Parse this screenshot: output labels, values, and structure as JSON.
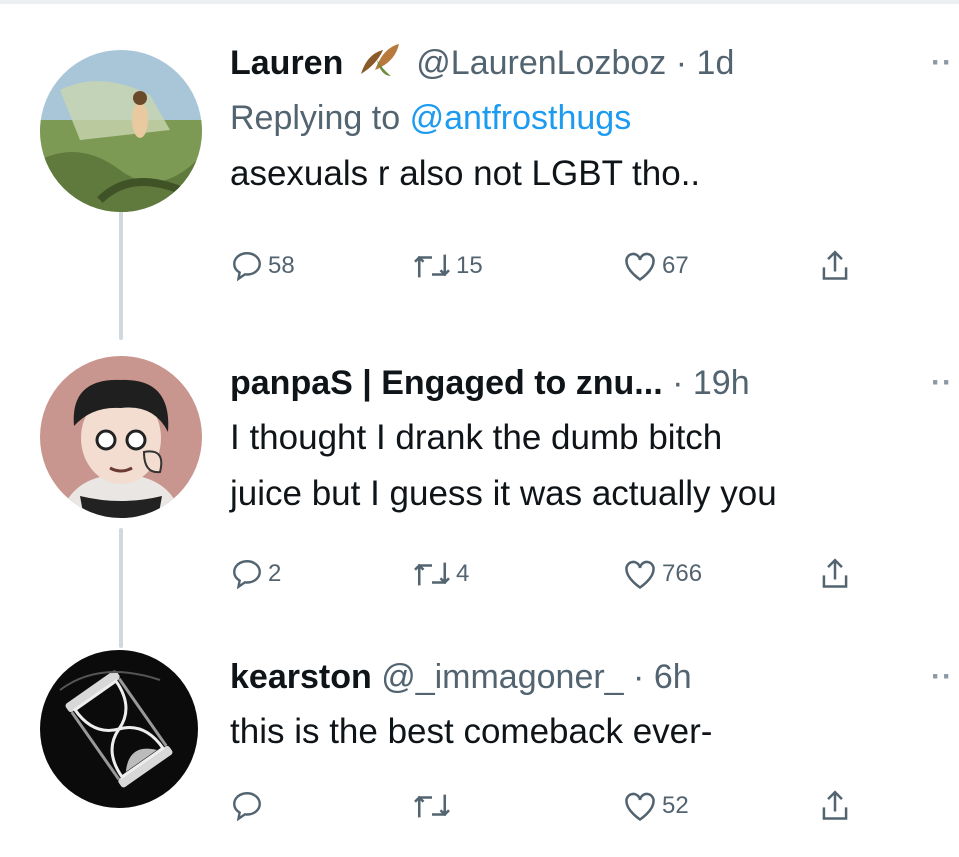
{
  "tweets": [
    {
      "name": "Lauren",
      "handle": "@LaurenLozboz",
      "separator": "·",
      "time": "1d",
      "replying_prefix": "Replying to",
      "replying_to": "@antfrosthugs",
      "text": [
        "asexuals r also not LGBT tho.."
      ],
      "replies": "58",
      "retweets": "15",
      "likes": "67",
      "more": "··"
    },
    {
      "name": "panpaS | Engaged to znu...",
      "separator": "·",
      "time": "19h",
      "text": [
        "I thought I drank the dumb bitch",
        "juice but I guess it was actually you"
      ],
      "replies": "2",
      "retweets": "4",
      "likes": "766",
      "more": "··"
    },
    {
      "name": "kearston",
      "handle": "@_immagoner_",
      "separator": "·",
      "time": "6h",
      "text": [
        "this is the best comeback ever-"
      ],
      "likes": "52",
      "more": "··"
    }
  ],
  "colors": {
    "text": "#0f1419",
    "secondary": "#536471",
    "link": "#1d9bf0",
    "thread_line": "#cfd9de"
  },
  "icons": [
    "leaf-emoji-icon",
    "reply-icon",
    "retweet-icon",
    "like-icon",
    "share-icon",
    "more-icon"
  ]
}
